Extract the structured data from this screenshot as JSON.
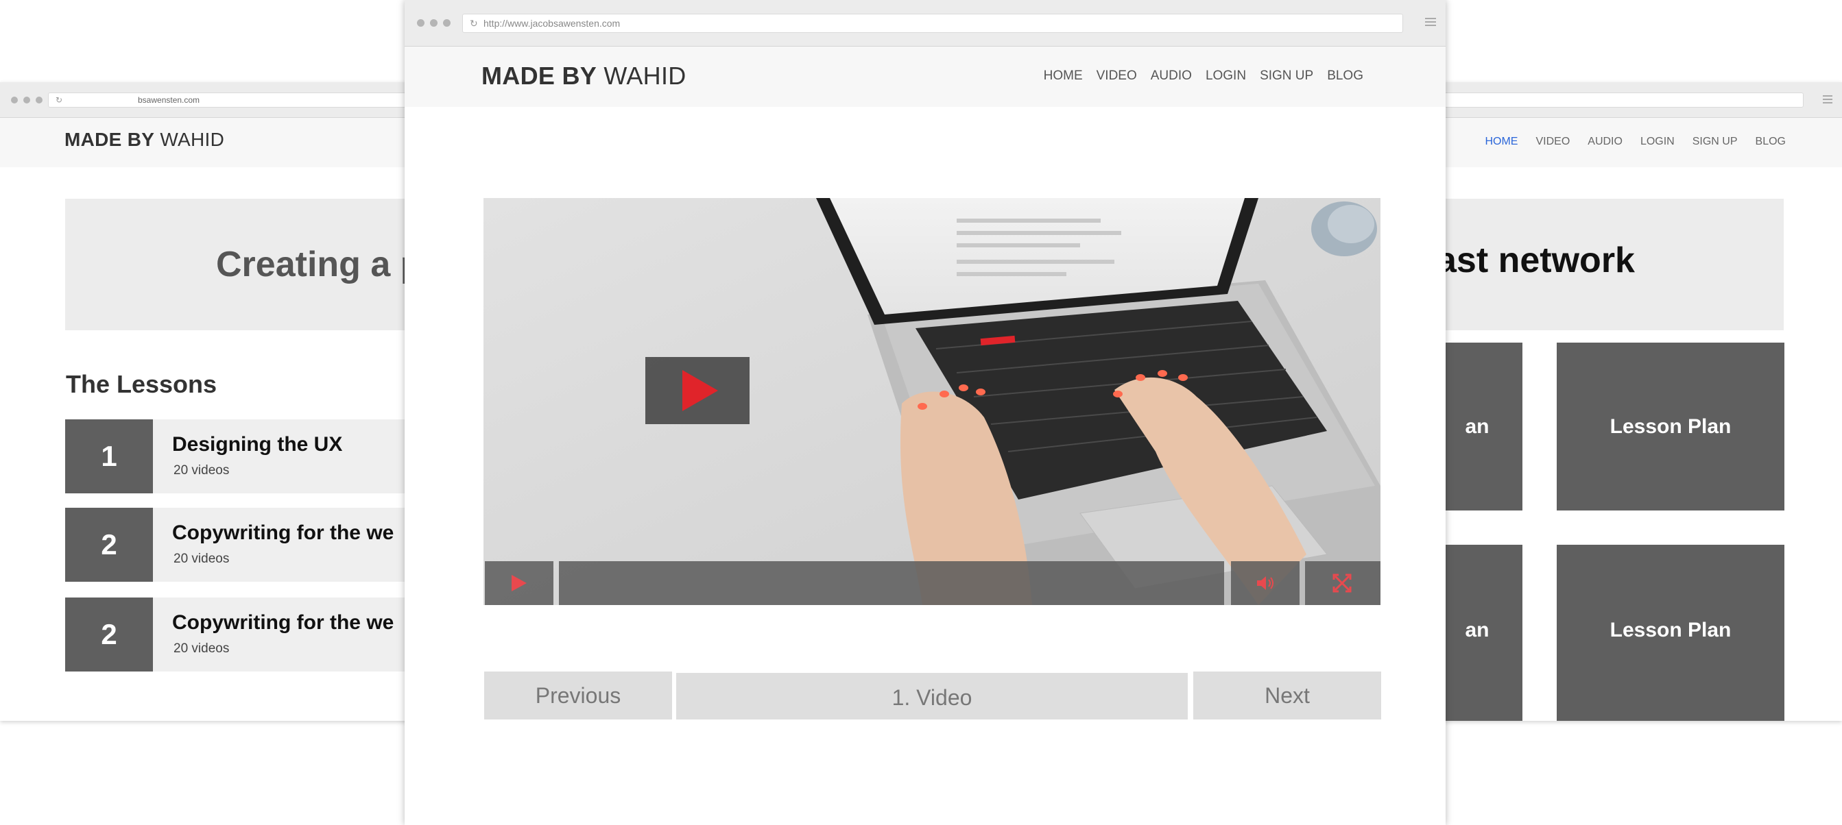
{
  "back_window": {
    "url": "bsawensten.com",
    "logo_bold": "MADE BY",
    "logo_light": "WAHID",
    "nav": [
      {
        "label": "HOME",
        "active": true
      },
      {
        "label": "VIDEO",
        "active": false
      },
      {
        "label": "AUDIO",
        "active": false
      },
      {
        "label": "LOGIN",
        "active": false
      },
      {
        "label": "SIGN UP",
        "active": false
      },
      {
        "label": "BLOG",
        "active": false
      }
    ],
    "course_title_left": "Creating a p",
    "course_title_right": "ast network",
    "lessons_heading": "The Lessons",
    "lessons": [
      {
        "number": "1",
        "title": "Designing the UX",
        "count": "20 videos"
      },
      {
        "number": "2",
        "title": "Copywriting for the we",
        "count": "20 videos"
      },
      {
        "number": "2",
        "title": "Copywriting for the we",
        "count": "20 videos"
      }
    ],
    "plan_tiles": [
      {
        "label": "an"
      },
      {
        "label": "Lesson Plan"
      },
      {
        "label": "an"
      },
      {
        "label": "Lesson Plan"
      }
    ]
  },
  "front_window": {
    "url": "http://www.jacobsawensten.com",
    "logo_bold": "MADE BY",
    "logo_light": "WAHID",
    "nav": [
      "HOME",
      "VIDEO",
      "AUDIO",
      "LOGIN",
      "SIGN UP",
      "BLOG"
    ],
    "video": {
      "thumbnail": "laptop-typing-image",
      "accent_color": "#e0242a"
    },
    "pager": {
      "previous": "Previous",
      "current": "1. Video",
      "next": "Next"
    }
  },
  "icons": {
    "play": "play-icon",
    "volume": "volume-icon",
    "fullscreen": "fullscreen-icon",
    "reload": "reload-icon",
    "menu": "menu-icon"
  }
}
